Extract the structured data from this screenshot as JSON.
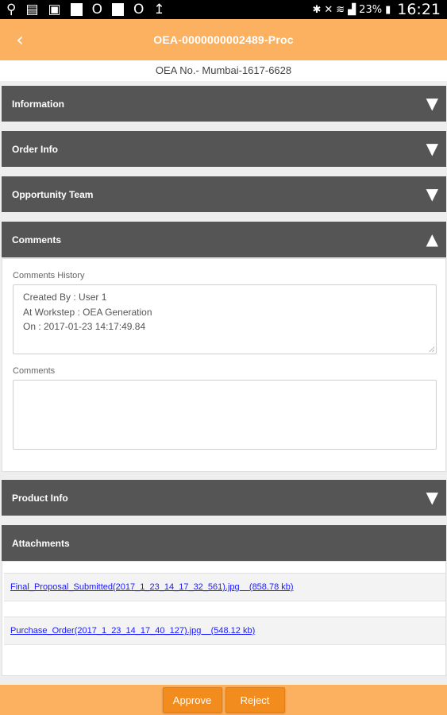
{
  "status_bar": {
    "battery": "23%",
    "time": "16:21"
  },
  "header": {
    "title": "OEA-0000000002489-Proc",
    "back_icon": "chevron-left-icon"
  },
  "oea_number": "OEA No.- Mumbai-1617-6628",
  "sections": {
    "information": "Information",
    "order_info": "Order Info",
    "opportunity_team": "Opportunity Team",
    "comments": "Comments",
    "product_info": "Product Info",
    "attachments": "Attachments"
  },
  "comments_panel": {
    "history_label": "Comments History",
    "history_lines": [
      "Created By : User 1",
      "At Workstep : OEA Generation",
      "On : 2017-01-23 14:17:49.84"
    ],
    "comments_label": "Comments",
    "comments_value": ""
  },
  "attachments": [
    {
      "name": "Final_Proposal_Submitted(2017_1_23_14_17_32_561).jpg",
      "size": "(858.78 kb)"
    },
    {
      "name": "Purchase_Order(2017_1_23_14_17_40_127).jpg",
      "size": "(548.12 kb)"
    }
  ],
  "footer": {
    "approve_label": "Approve",
    "reject_label": "Reject"
  },
  "colors": {
    "accent": "#fbb15f",
    "button": "#f28c1e",
    "section_header": "#555555",
    "link": "#1a1aff"
  }
}
